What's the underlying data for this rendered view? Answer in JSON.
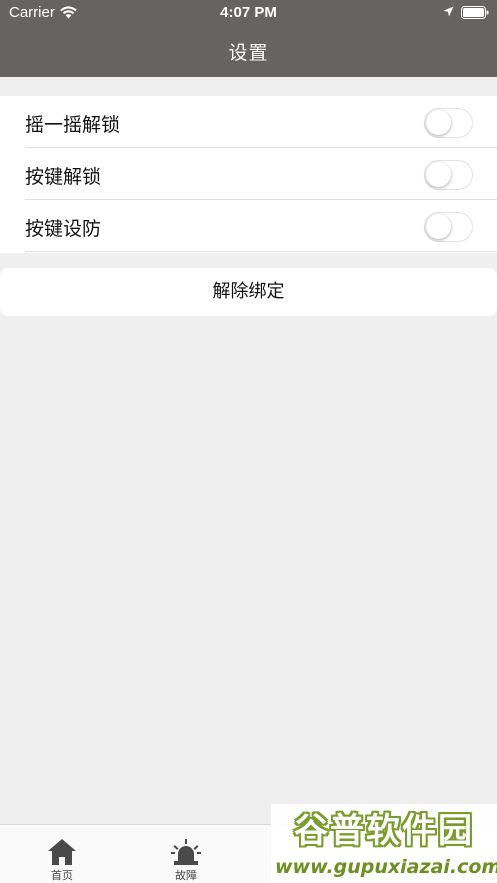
{
  "status_bar": {
    "carrier": "Carrier",
    "time": "4:07 PM"
  },
  "nav": {
    "title": "设置"
  },
  "settings": [
    {
      "label": "摇一摇解锁",
      "enabled": false
    },
    {
      "label": "按键解锁",
      "enabled": false
    },
    {
      "label": "按键设防",
      "enabled": false
    }
  ],
  "unbind_button": {
    "label": "解除绑定"
  },
  "tab_bar": {
    "items": [
      {
        "label": "首页",
        "icon": "home-icon"
      },
      {
        "label": "故障",
        "icon": "alarm-icon"
      }
    ]
  },
  "watermark": {
    "logo": "谷普软件园",
    "url": "www.gupuxiazai.com"
  },
  "colors": {
    "header_bg": "#666363",
    "page_bg": "#efefef",
    "watermark_green": "#7a9c2a"
  }
}
